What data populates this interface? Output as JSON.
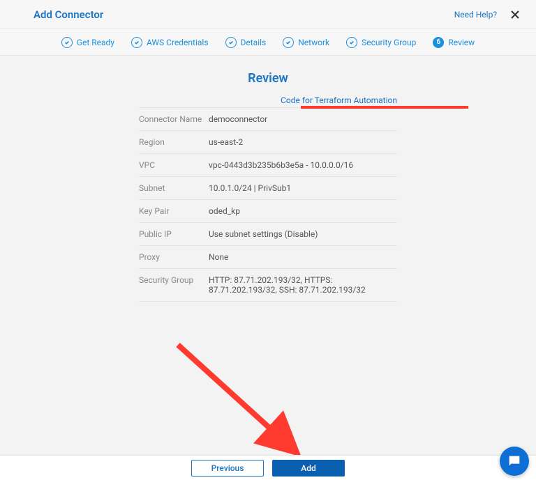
{
  "header": {
    "title": "Add Connector",
    "need_help": "Need Help?"
  },
  "stepper": {
    "steps": [
      {
        "label": "Get Ready"
      },
      {
        "label": "AWS Credentials"
      },
      {
        "label": "Details"
      },
      {
        "label": "Network"
      },
      {
        "label": "Security Group"
      },
      {
        "label": "Review",
        "number": "6",
        "active": true
      }
    ]
  },
  "review": {
    "title": "Review",
    "terraform_link": "Code for Terraform Automation",
    "rows": [
      {
        "label": "Connector Name",
        "value": "democonnector"
      },
      {
        "label": "Region",
        "value": "us-east-2"
      },
      {
        "label": "VPC",
        "value": "vpc-0443d3b235b6b3e5a - 10.0.0.0/16"
      },
      {
        "label": "Subnet",
        "value": "10.0.1.0/24 | PrivSub1"
      },
      {
        "label": "Key Pair",
        "value": "oded_kp"
      },
      {
        "label": "Public IP",
        "value": "Use subnet settings (Disable)"
      },
      {
        "label": "Proxy",
        "value": "None"
      },
      {
        "label": "Security Group",
        "value": "HTTP: 87.71.202.193/32, HTTPS: 87.71.202.193/32, SSH: 87.71.202.193/32"
      }
    ]
  },
  "footer": {
    "previous": "Previous",
    "add": "Add"
  }
}
